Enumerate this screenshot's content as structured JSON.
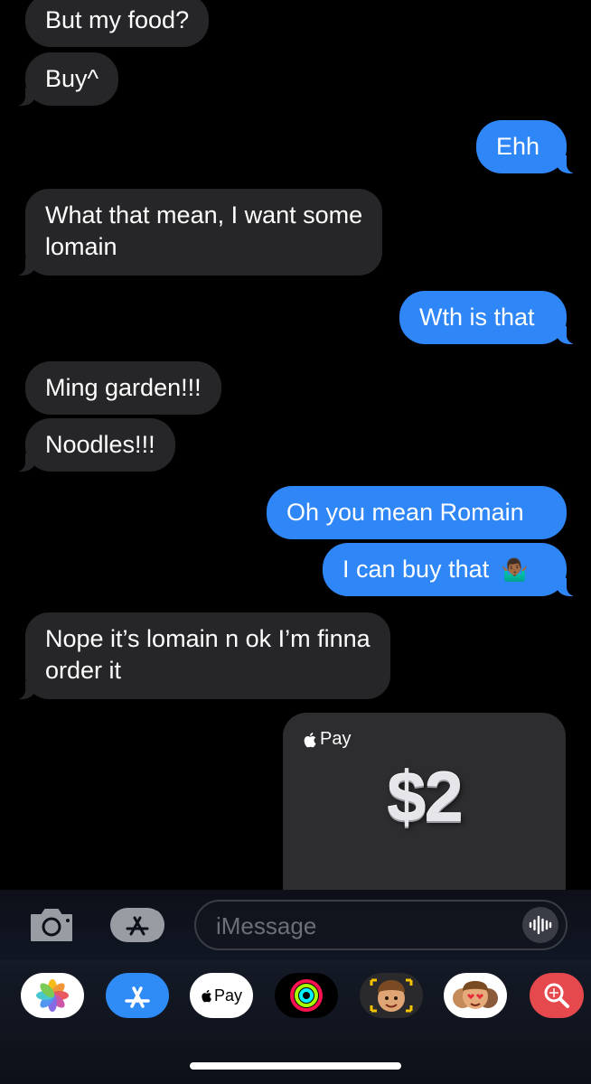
{
  "messages": [
    {
      "dir": "in",
      "text": "But my food?"
    },
    {
      "dir": "in",
      "text": "Buy^"
    },
    {
      "dir": "out",
      "text": "Ehh"
    },
    {
      "dir": "in",
      "line1": "What that mean, I want some",
      "line2": "lomain"
    },
    {
      "dir": "out",
      "text": "Wth is that"
    },
    {
      "dir": "in",
      "text": "Ming garden!!!"
    },
    {
      "dir": "in",
      "text": "Noodles!!!"
    },
    {
      "dir": "out",
      "text": "Oh you mean Romain"
    },
    {
      "dir": "out",
      "text": "I can buy that",
      "emoji": "🤷🏾‍♂️"
    },
    {
      "dir": "in",
      "line1": "Nope it’s lomain n ok I’m finna",
      "line2": "order it"
    }
  ],
  "apple_pay": {
    "label": "Pay",
    "amount": "$2"
  },
  "composer": {
    "placeholder": "iMessage"
  },
  "app_drawer": {
    "pay_label": "Pay"
  },
  "colors": {
    "incoming": "#262628",
    "outgoing": "#2f86f7",
    "background": "#000000"
  },
  "icons": [
    "camera-icon",
    "app-store-icon",
    "audio-waveform-icon",
    "photos-app-icon",
    "app-store-app-icon",
    "apple-pay-app-icon",
    "activity-app-icon",
    "memoji-app-icon",
    "memoji-stickers-app-icon",
    "image-search-app-icon"
  ]
}
